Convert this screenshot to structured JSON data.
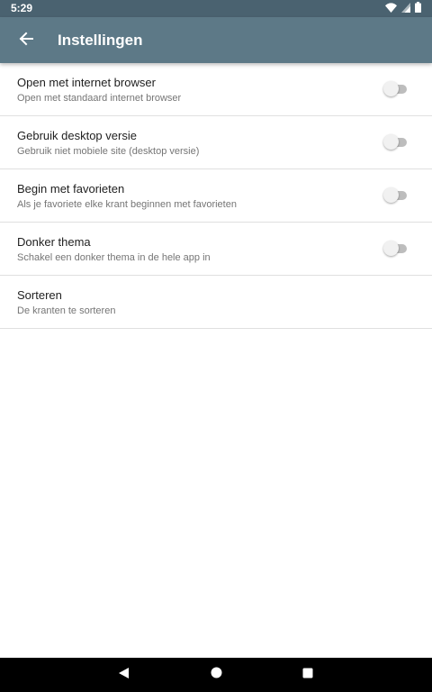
{
  "status_bar": {
    "time": "5:29",
    "icons": [
      "wifi-icon",
      "signal-icon",
      "battery-icon"
    ]
  },
  "app_bar": {
    "title": "Instellingen",
    "back_icon": "arrow-back-icon",
    "background": "#5d7987"
  },
  "settings": [
    {
      "title": "Open met internet browser",
      "summary": "Open met standaard internet browser",
      "toggle": false
    },
    {
      "title": "Gebruik desktop versie",
      "summary": "Gebruik niet mobiele site (desktop versie)",
      "toggle": false
    },
    {
      "title": "Begin met favorieten",
      "summary": "Als je favoriete elke krant beginnen met favorieten",
      "toggle": false
    },
    {
      "title": "Donker thema",
      "summary": "Schakel een donker thema in de hele app in",
      "toggle": false
    },
    {
      "title": "Sorteren",
      "summary": "De kranten te sorteren"
    }
  ],
  "nav_bar": {
    "icons": [
      "back-triangle-icon",
      "home-circle-icon",
      "recents-square-icon"
    ]
  }
}
